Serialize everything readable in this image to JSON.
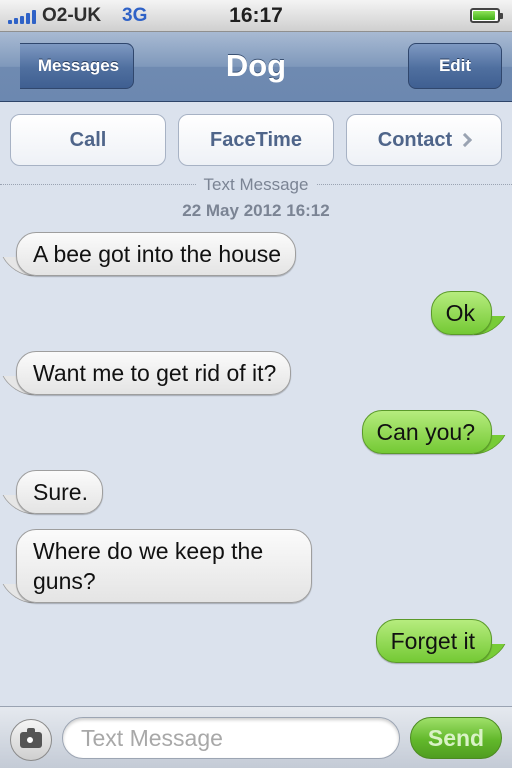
{
  "status_bar": {
    "carrier": "O2-UK",
    "network": "3G",
    "time": "16:17",
    "battery_level": 0.9,
    "signal_bars": 5
  },
  "nav": {
    "back_label": "Messages",
    "title": "Dog",
    "edit_label": "Edit"
  },
  "actions": {
    "call_label": "Call",
    "facetime_label": "FaceTime",
    "contact_label": "Contact"
  },
  "conversation": {
    "header": "Text Message",
    "date": "22 May 2012 16:12",
    "messages": [
      {
        "from": "them",
        "text": "A bee got into the house"
      },
      {
        "from": "me",
        "text": "Ok"
      },
      {
        "from": "them",
        "text": "Want me to get rid of it?"
      },
      {
        "from": "me",
        "text": "Can you?"
      },
      {
        "from": "them",
        "text": "Sure."
      },
      {
        "from": "them",
        "text": "Where do we keep the guns?"
      },
      {
        "from": "me",
        "text": "Forget it"
      }
    ]
  },
  "composer": {
    "placeholder": "Text Message",
    "value": "",
    "send_label": "Send"
  },
  "colors": {
    "incoming_bubble": "#eeeeee",
    "outgoing_bubble": "#8fd84f",
    "nav_bar": "#7f98bb",
    "background": "#dbe2ed",
    "action_text": "#4f658a"
  },
  "icons": {
    "back": "back-arrow-icon",
    "camera": "camera-icon",
    "contact_chevron": "chevron-right-icon",
    "battery": "battery-icon",
    "signal": "signal-bars-icon"
  }
}
